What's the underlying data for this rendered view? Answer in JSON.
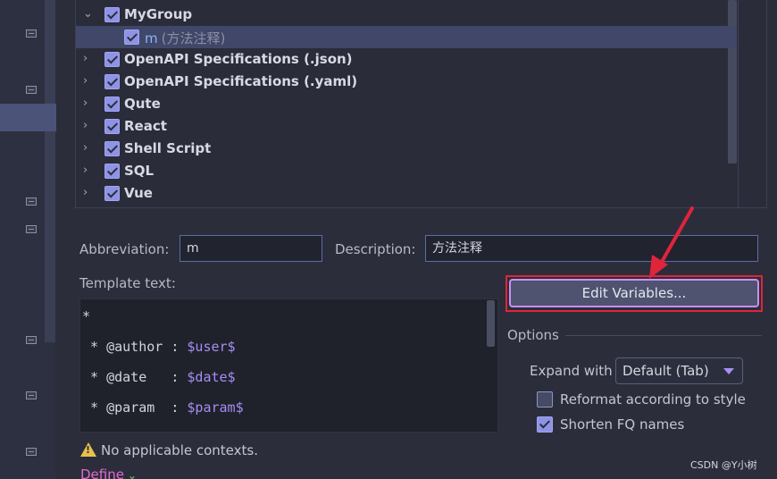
{
  "tree": {
    "groups": [
      {
        "label": "MyGroup",
        "expanded": true,
        "checked": true
      },
      {
        "label": "OpenAPI Specifications (.json)",
        "expanded": false,
        "checked": true
      },
      {
        "label": "OpenAPI Specifications (.yaml)",
        "expanded": false,
        "checked": true
      },
      {
        "label": "Qute",
        "expanded": false,
        "checked": true
      },
      {
        "label": "React",
        "expanded": false,
        "checked": true
      },
      {
        "label": "Shell Script",
        "expanded": false,
        "checked": true
      },
      {
        "label": "SQL",
        "expanded": false,
        "checked": true
      },
      {
        "label": "Vue",
        "expanded": false,
        "checked": true
      }
    ],
    "selected_child": {
      "name": "m",
      "description": "(方法注释)",
      "checked": true
    }
  },
  "form": {
    "abbreviation_label": "Abbreviation:",
    "abbreviation_value": "m",
    "description_label": "Description:",
    "description_value": "方法注释",
    "template_text_label": "Template text:"
  },
  "template_lines": [
    {
      "text": "*",
      "var": ""
    },
    {
      "text": " * @author : ",
      "var": "$user$"
    },
    {
      "text": " * @date   : ",
      "var": "$date$"
    },
    {
      "text": " * @param  : ",
      "var": "$param$"
    }
  ],
  "buttons": {
    "edit_variables": "Edit Variables..."
  },
  "options": {
    "title": "Options",
    "expand_with_label": "Expand with",
    "expand_with_value": "Default (Tab)",
    "reformat_label": "Reformat according to style",
    "reformat_checked": false,
    "shorten_label": "Shorten FQ names",
    "shorten_checked": true
  },
  "status": {
    "warning": "No applicable contexts.",
    "define_link": "Define"
  },
  "watermark": "CSDN @Y小树",
  "colors": {
    "accent": "#8f93e6",
    "highlight_box": "#e0243a",
    "variable": "#a58ef4",
    "link": "#e06bd2"
  }
}
